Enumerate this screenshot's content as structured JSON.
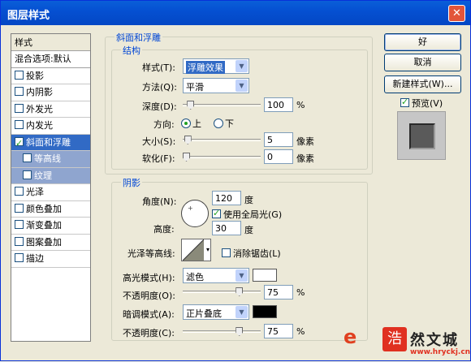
{
  "window": {
    "title": "图层样式",
    "close_icon": "close-icon"
  },
  "sidebar": {
    "header": "样式",
    "blend": "混合选项:默认",
    "items": [
      {
        "label": "投影",
        "checked": false
      },
      {
        "label": "内阴影",
        "checked": false
      },
      {
        "label": "外发光",
        "checked": false
      },
      {
        "label": "内发光",
        "checked": false
      },
      {
        "label": "斜面和浮雕",
        "checked": true
      },
      {
        "label": "等高线",
        "checked": false
      },
      {
        "label": "纹理",
        "checked": false
      },
      {
        "label": "光泽",
        "checked": false
      },
      {
        "label": "颜色叠加",
        "checked": false
      },
      {
        "label": "渐变叠加",
        "checked": false
      },
      {
        "label": "图案叠加",
        "checked": false
      },
      {
        "label": "描边",
        "checked": false
      }
    ]
  },
  "bevel": {
    "group_title": "斜面和浮雕",
    "structure_title": "结构",
    "style_label": "样式(T):",
    "style_value": "浮雕效果",
    "method_label": "方法(Q):",
    "method_value": "平滑",
    "depth_label": "深度(D):",
    "depth_value": "100",
    "depth_unit": "%",
    "depth_level": 0.06,
    "direction_label": "方向:",
    "dir_up": "上",
    "dir_down": "下",
    "direction_selected": "up",
    "size_label": "大小(S):",
    "size_value": "5",
    "size_unit": "像素",
    "size_level": 0.02,
    "soften_label": "软化(F):",
    "soften_value": "0",
    "soften_unit": "像素",
    "soften_level": 0.0
  },
  "shading": {
    "title": "阴影",
    "angle_label": "角度(N):",
    "angle_value": "120",
    "angle_unit": "度",
    "global_light_label": "使用全局光(G)",
    "global_light_checked": true,
    "altitude_label": "高度:",
    "altitude_value": "30",
    "altitude_unit": "度",
    "contour_label": "光泽等高线:",
    "antialias_label": "消除锯齿(L)",
    "antialias_checked": false,
    "highlight_mode_label": "高光模式(H):",
    "highlight_mode_value": "滤色",
    "highlight_color": "#ffffff",
    "highlight_opacity_label": "不透明度(O):",
    "highlight_opacity_value": "75",
    "highlight_opacity_unit": "%",
    "highlight_opacity_level": 0.75,
    "shadow_mode_label": "暗调模式(A):",
    "shadow_mode_value": "正片叠底",
    "shadow_color": "#000000",
    "shadow_opacity_label": "不透明度(C):",
    "shadow_opacity_value": "75",
    "shadow_opacity_unit": "%",
    "shadow_opacity_level": 0.75
  },
  "buttons": {
    "ok": "好",
    "cancel": "取消",
    "new_style": "新建样式(W)...",
    "preview": "预览(V)",
    "preview_checked": true
  },
  "watermark": {
    "logo": "e",
    "seal": "浩",
    "cn": "然文城",
    "url": "www.hryckj.cn"
  }
}
